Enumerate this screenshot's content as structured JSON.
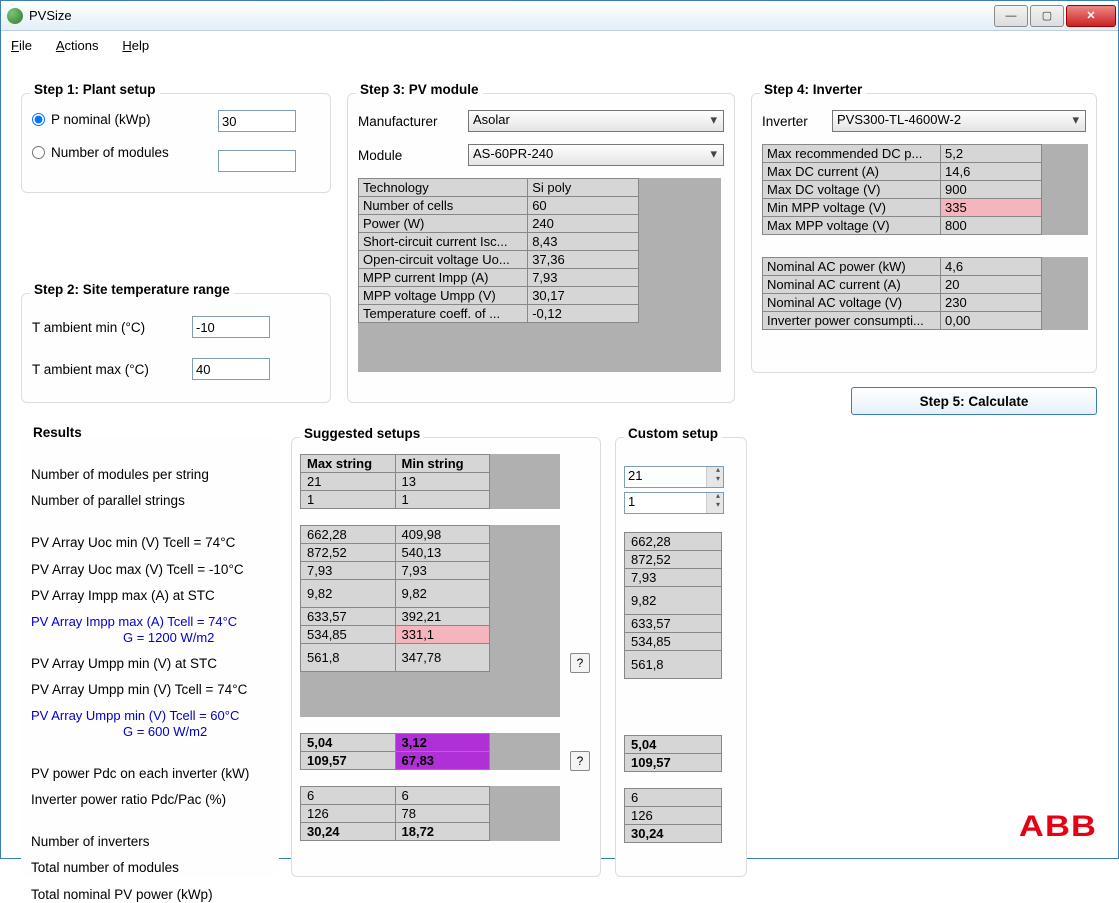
{
  "window": {
    "title": "PVSize"
  },
  "menu": {
    "file": "File",
    "actions": "Actions",
    "help": "Help"
  },
  "step1": {
    "title": "Step 1: Plant setup",
    "pnominal_label": "P nominal (kWp)",
    "pnominal_value": "30",
    "nmodules_label": "Number of modules",
    "nmodules_value": ""
  },
  "step2": {
    "title": "Step 2: Site temperature range",
    "tmin_label": "T ambient min (°C)",
    "tmin_value": "-10",
    "tmax_label": "T ambient max (°C)",
    "tmax_value": "40"
  },
  "step3": {
    "title": "Step 3: PV module",
    "manufacturer_label": "Manufacturer",
    "manufacturer_value": "Asolar",
    "module_label": "Module",
    "module_value": "AS-60PR-240",
    "props": [
      [
        "Technology",
        "Si poly"
      ],
      [
        "Number of cells",
        "60"
      ],
      [
        "Power (W)",
        "240"
      ],
      [
        "Short-circuit current Isc...",
        "8,43"
      ],
      [
        "Open-circuit voltage Uo...",
        "37,36"
      ],
      [
        "MPP current Impp (A)",
        "7,93"
      ],
      [
        "MPP voltage Umpp (V)",
        "30,17"
      ],
      [
        "Temperature coeff. of ...",
        "-0,12"
      ]
    ]
  },
  "step4": {
    "title": "Step 4: Inverter",
    "inverter_label": "Inverter",
    "inverter_value": "PVS300-TL-4600W-2",
    "dc_props": [
      [
        "Max recommended DC p...",
        "5,2"
      ],
      [
        "Max DC current (A)",
        "14,6"
      ],
      [
        "Max DC voltage (V)",
        "900"
      ],
      [
        "Min MPP voltage (V)",
        "335"
      ],
      [
        "Max MPP voltage (V)",
        "800"
      ]
    ],
    "ac_props": [
      [
        "Nominal AC power (kW)",
        "4,6"
      ],
      [
        "Nominal AC current (A)",
        "20"
      ],
      [
        "Nominal AC voltage (V)",
        "230"
      ],
      [
        "Inverter power consumpti...",
        "0,00"
      ]
    ]
  },
  "step5": {
    "label": "Step 5: Calculate"
  },
  "results": {
    "title": "Results",
    "labels": [
      "Number of modules per string",
      "Number of parallel strings",
      "PV Array Uoc min (V) Tcell = 74°C",
      "PV Array Uoc max (V) Tcell = -10°C",
      "PV Array Impp max (A) at STC",
      "PV Array Impp max (A) Tcell = 74°C",
      "G = 1200 W/m2",
      "PV Array Umpp min (V) at STC",
      "PV Array Umpp min (V) Tcell = 74°C",
      "PV Array Umpp min (V) Tcell = 60°C",
      "G = 600 W/m2",
      "PV power Pdc on each inverter (kW)",
      "Inverter power ratio Pdc/Pac (%)",
      "Number of inverters",
      "Total number of modules",
      "Total nominal PV power (kWp)"
    ]
  },
  "suggested": {
    "title": "Suggested setups",
    "headers": [
      "Max string",
      "Min string"
    ],
    "g1": [
      [
        "21",
        "13"
      ],
      [
        "1",
        "1"
      ]
    ],
    "g2": [
      [
        "662,28",
        "409,98"
      ],
      [
        "872,52",
        "540,13"
      ],
      [
        "7,93",
        "7,93"
      ],
      [
        "9,82",
        "9,82"
      ],
      [
        "633,57",
        "392,21"
      ],
      [
        "534,85",
        "331,1"
      ],
      [
        "561,8",
        "347,78"
      ]
    ],
    "g3": [
      [
        "5,04",
        "3,12"
      ],
      [
        "109,57",
        "67,83"
      ]
    ],
    "g4": [
      [
        "6",
        "6"
      ],
      [
        "126",
        "78"
      ],
      [
        "30,24",
        "18,72"
      ]
    ]
  },
  "custom": {
    "title": "Custom setup",
    "spin1": "21",
    "spin2": "1",
    "g2": [
      "662,28",
      "872,52",
      "7,93",
      "9,82",
      "633,57",
      "534,85",
      "561,8"
    ],
    "g3": [
      "5,04",
      "109,57"
    ],
    "g4": [
      "6",
      "126",
      "30,24"
    ]
  },
  "logo": "ABB",
  "help_q": "?"
}
